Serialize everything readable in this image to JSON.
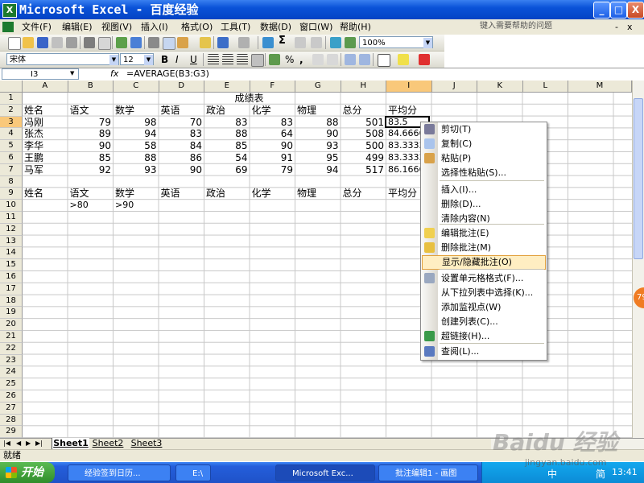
{
  "window": {
    "title": "Microsoft Excel - 百度经验",
    "buttons": [
      "_",
      "□",
      "X"
    ]
  },
  "menubar": {
    "items": [
      "文件(F)",
      "编辑(E)",
      "视图(V)",
      "插入(I)",
      "格式(O)",
      "工具(T)",
      "数据(D)",
      "窗口(W)",
      "帮助(H)"
    ],
    "help_placeholder": "键入需要帮助的问题",
    "doc_controls": [
      "-",
      "x"
    ]
  },
  "toolbar": {
    "zoom": "100%",
    "font": "宋体",
    "font_size": "12",
    "bold": "B",
    "italic": "I",
    "underline": "U",
    "percent": "%",
    "comma": ","
  },
  "formula_bar": {
    "cell_ref": "I3",
    "fx": "fx",
    "formula": "=AVERAGE(B3:G3)"
  },
  "columns": [
    "A",
    "B",
    "C",
    "D",
    "E",
    "F",
    "G",
    "H",
    "I",
    "J",
    "K",
    "L",
    "M"
  ],
  "rows": [
    "1",
    "2",
    "3",
    "4",
    "5",
    "6",
    "7",
    "8",
    "9",
    "10",
    "11",
    "12",
    "13",
    "14",
    "15",
    "16",
    "17",
    "18",
    "19",
    "20",
    "21",
    "22",
    "23",
    "24",
    "25",
    "26",
    "27",
    "28",
    "29"
  ],
  "sheet": {
    "title": "成绩表",
    "headers": [
      "姓名",
      "语文",
      "数学",
      "英语",
      "政治",
      "化学",
      "物理",
      "总分",
      "平均分"
    ],
    "data": [
      [
        "冯刚",
        "79",
        "98",
        "70",
        "83",
        "83",
        "88",
        "501",
        "83.5"
      ],
      [
        "张杰",
        "89",
        "94",
        "83",
        "88",
        "64",
        "90",
        "508",
        "84.6666"
      ],
      [
        "李华",
        "90",
        "58",
        "84",
        "85",
        "90",
        "93",
        "500",
        "83.3333"
      ],
      [
        "王鹏",
        "85",
        "88",
        "86",
        "54",
        "91",
        "95",
        "499",
        "83.3333"
      ],
      [
        "马军",
        "92",
        "93",
        "90",
        "69",
        "79",
        "94",
        "517",
        "86.1666"
      ]
    ],
    "criteria_headers": [
      "姓名",
      "语文",
      "数学",
      "英语",
      "政治",
      "化学",
      "物理",
      "总分",
      "平均分"
    ],
    "criteria": [
      "",
      ">80",
      ">90"
    ]
  },
  "sheet_tabs": [
    "Sheet1",
    "Sheet2",
    "Sheet3"
  ],
  "status": "就绪",
  "context_menu": [
    {
      "label": "剪切(T)",
      "icon": "scissors-icon"
    },
    {
      "label": "复制(C)",
      "icon": "copy-icon"
    },
    {
      "label": "粘贴(P)",
      "icon": "paste-icon"
    },
    {
      "label": "选择性粘贴(S)...",
      "icon": ""
    },
    {
      "label": "插入(I)...",
      "icon": ""
    },
    {
      "label": "删除(D)...",
      "icon": ""
    },
    {
      "label": "清除内容(N)",
      "icon": ""
    },
    {
      "label": "编辑批注(E)",
      "icon": "edit-comment-icon"
    },
    {
      "label": "删除批注(M)",
      "icon": "delete-comment-icon"
    },
    {
      "label": "显示/隐藏批注(O)",
      "icon": ""
    },
    {
      "label": "设置单元格格式(F)...",
      "icon": "format-cells-icon"
    },
    {
      "label": "从下拉列表中选择(K)...",
      "icon": ""
    },
    {
      "label": "添加监视点(W)",
      "icon": ""
    },
    {
      "label": "创建列表(C)...",
      "icon": ""
    },
    {
      "label": "超链接(H)...",
      "icon": "hyperlink-icon"
    },
    {
      "label": "查阅(L)...",
      "icon": "research-icon"
    }
  ],
  "taskbar": {
    "start": "开始",
    "items": [
      "经验签到日历...",
      "E:\\",
      "Microsoft Exc...",
      "批注编辑1 - 画图"
    ],
    "tray_text": "中",
    "tray_text2": "简",
    "clock": "13:41"
  },
  "badge": "79",
  "watermark": {
    "text": "Baidu 经验",
    "url": "jingyan.baidu.com"
  }
}
